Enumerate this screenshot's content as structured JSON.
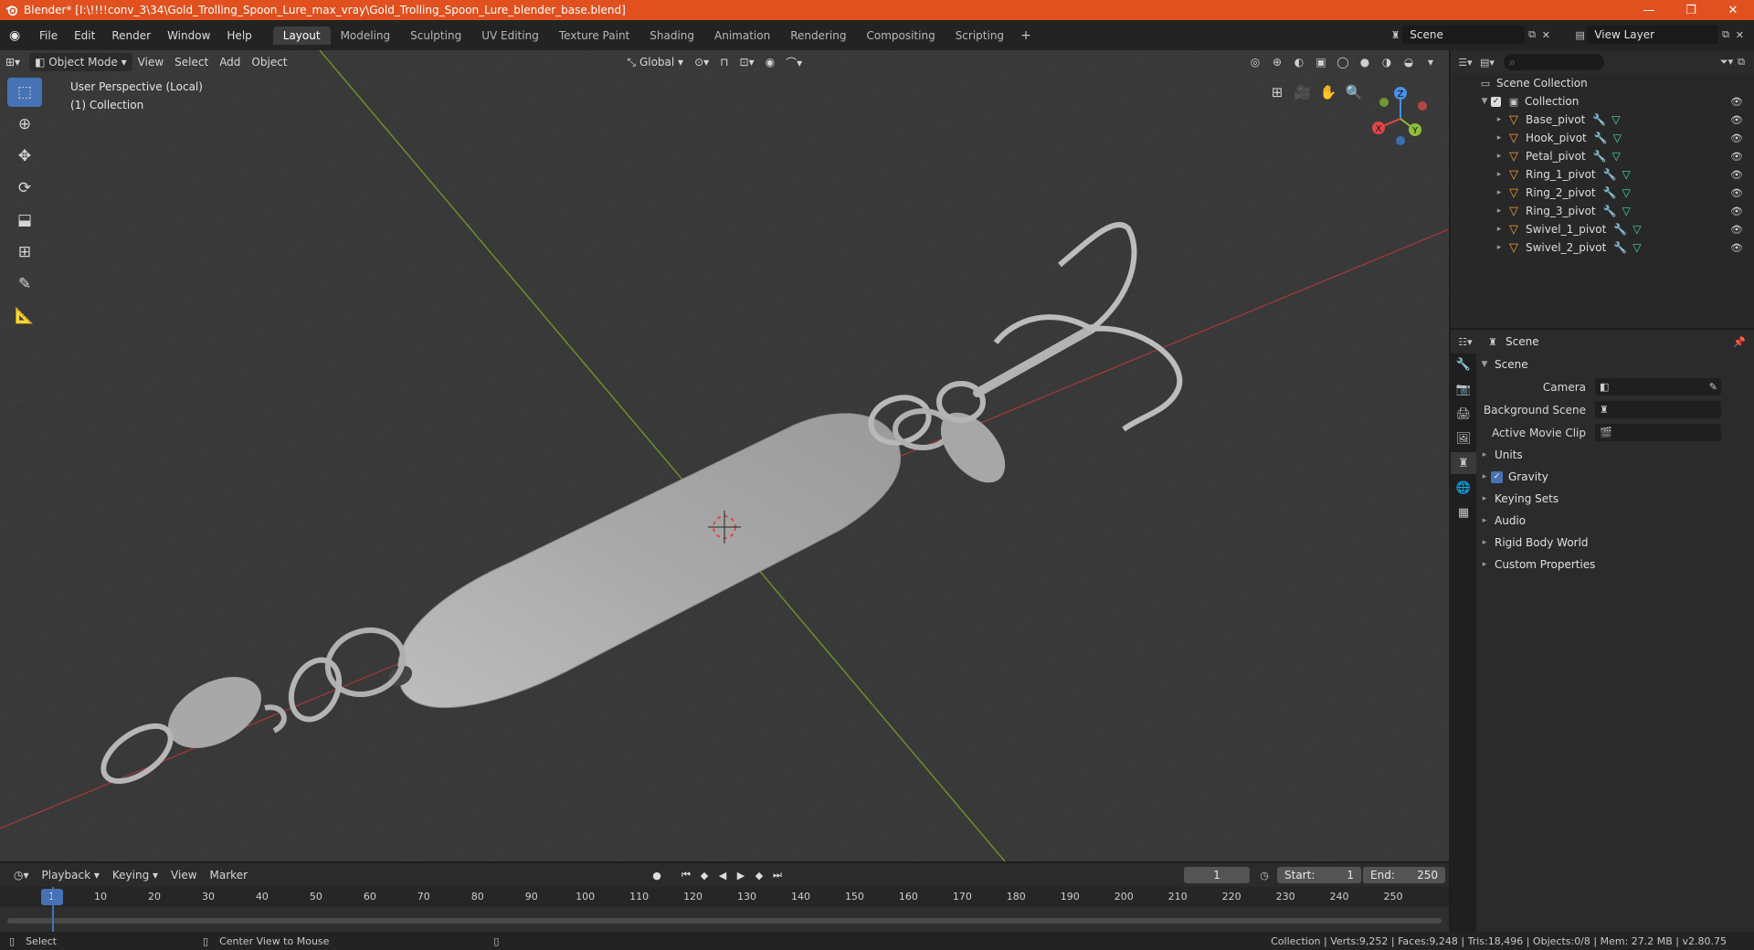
{
  "window": {
    "title": "Blender* [I:\\!!!!conv_3\\34\\Gold_Trolling_Spoon_Lure_max_vray\\Gold_Trolling_Spoon_Lure_blender_base.blend]",
    "minimize": "—",
    "restore": "❐",
    "close": "✕"
  },
  "menu": [
    "File",
    "Edit",
    "Render",
    "Window",
    "Help"
  ],
  "workspaces": [
    "Layout",
    "Modeling",
    "Sculpting",
    "UV Editing",
    "Texture Paint",
    "Shading",
    "Animation",
    "Rendering",
    "Compositing",
    "Scripting"
  ],
  "workspace_add": "+",
  "scene_name": "Scene",
  "view_layer": "View Layer",
  "viewport": {
    "mode": "Object Mode",
    "menus": [
      "View",
      "Select",
      "Add",
      "Object"
    ],
    "orientation": "Global",
    "info_line1": "User Perspective (Local)",
    "info_line2": "(1) Collection",
    "gizmo": {
      "x": "X",
      "y": "Y",
      "z": "Z"
    }
  },
  "outliner": {
    "root": "Scene Collection",
    "collection": "Collection",
    "objects": [
      "Base_pivot",
      "Hook_pivot",
      "Petal_pivot",
      "Ring_1_pivot",
      "Ring_2_pivot",
      "Ring_3_pivot",
      "Swivel_1_pivot",
      "Swivel_2_pivot"
    ]
  },
  "properties": {
    "header": "Scene",
    "panel": "Scene",
    "camera_label": "Camera",
    "background_label": "Background Scene",
    "movieclip_label": "Active Movie Clip",
    "sections": [
      "Units",
      "Gravity",
      "Keying Sets",
      "Audio",
      "Rigid Body World",
      "Custom Properties"
    ]
  },
  "timeline": {
    "menus": [
      "Playback",
      "Keying",
      "View",
      "Marker"
    ],
    "current_frame": "1",
    "start_label": "Start:",
    "start": "1",
    "end_label": "End:",
    "end": "250",
    "ticks": [
      "10",
      "20",
      "30",
      "40",
      "50",
      "60",
      "70",
      "80",
      "90",
      "100",
      "110",
      "120",
      "130",
      "140",
      "150",
      "160",
      "170",
      "180",
      "190",
      "200",
      "210",
      "220",
      "230",
      "240",
      "250"
    ]
  },
  "status": {
    "select": "Select",
    "center": "Center View to Mouse",
    "stats": "Collection | Verts:9,252 | Faces:9,248 | Tris:18,496 | Objects:0/8 | Mem: 27.2 MB | v2.80.75"
  },
  "colors": {
    "accent": "#4772b3",
    "titlebar": "#e1501f",
    "object_icon": "#f49d38",
    "x_axis": "#e04848",
    "y_axis": "#8fbf3a",
    "z_axis": "#4a8fe8"
  }
}
